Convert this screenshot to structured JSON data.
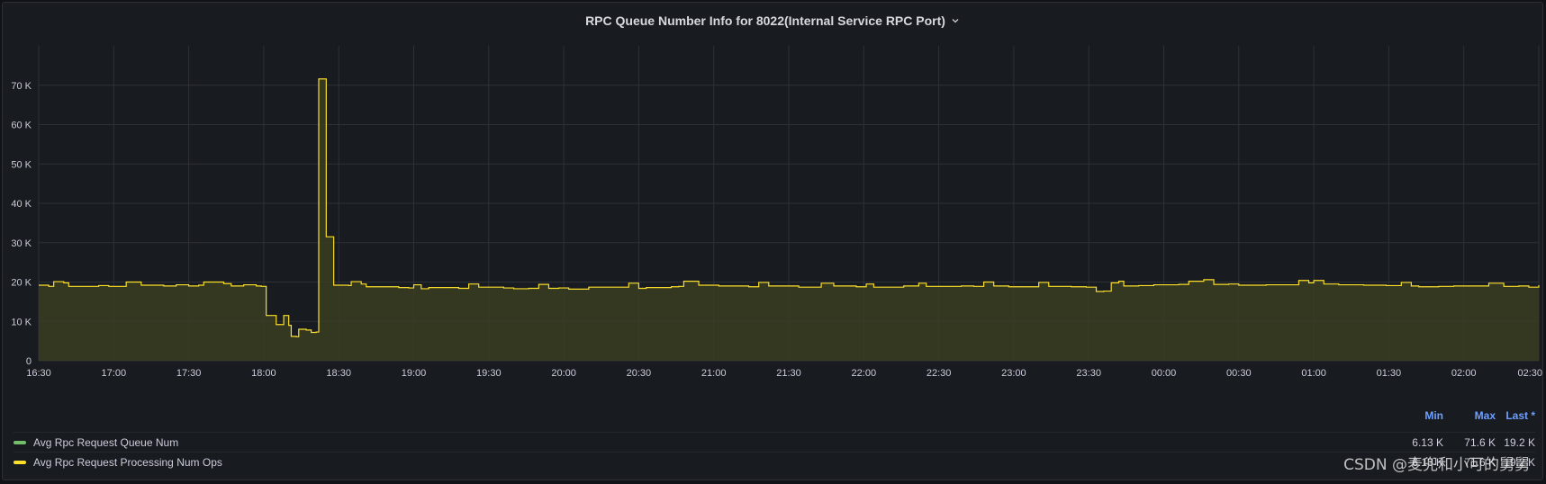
{
  "panel": {
    "title": "RPC Queue Number Info for 8022(Internal Service RPC Port)"
  },
  "colors": {
    "background": "#181b1f",
    "grid": "#2e3138",
    "axis_text": "#ccccdc",
    "series_green": "#73bf69",
    "series_yellow": "#fade2a",
    "area_fill": "#3a3d22"
  },
  "chart_data": {
    "type": "area",
    "x_ticks": [
      "16:30",
      "17:00",
      "17:30",
      "18:00",
      "18:30",
      "19:00",
      "19:30",
      "20:00",
      "20:30",
      "21:00",
      "21:30",
      "22:00",
      "22:30",
      "23:00",
      "23:30",
      "00:00",
      "00:30",
      "01:00",
      "01:30",
      "02:00",
      "02:30"
    ],
    "x_start_minutes": 0,
    "x_end_minutes": 600,
    "ylim": [
      0,
      80000
    ],
    "y_ticks": [
      0,
      10000,
      20000,
      30000,
      40000,
      50000,
      60000,
      70000
    ],
    "y_tick_labels": [
      "0",
      "10 K",
      "20 K",
      "30 K",
      "40 K",
      "50 K",
      "60 K",
      "70 K"
    ],
    "grid": true,
    "legend_position": "bottom",
    "series": [
      {
        "name": "Avg Rpc Request Queue Num",
        "color": "#73bf69",
        "min": "6.13 K",
        "max": "71.6 K",
        "last": "19.2 K"
      },
      {
        "name": "Avg Rpc Request Processing Num Ops",
        "color": "#fade2a",
        "min": "6.13 K",
        "max": "71.6 K",
        "last": "19.2 K",
        "points": [
          [
            0,
            19200
          ],
          [
            4,
            18900
          ],
          [
            6,
            20100
          ],
          [
            10,
            19800
          ],
          [
            12,
            18900
          ],
          [
            20,
            18900
          ],
          [
            24,
            19100
          ],
          [
            28,
            18900
          ],
          [
            35,
            20000
          ],
          [
            41,
            19200
          ],
          [
            50,
            19000
          ],
          [
            55,
            19300
          ],
          [
            60,
            19000
          ],
          [
            64,
            19200
          ],
          [
            66,
            20000
          ],
          [
            74,
            19600
          ],
          [
            77,
            19000
          ],
          [
            82,
            19300
          ],
          [
            87,
            19000
          ],
          [
            89,
            18900
          ],
          [
            91,
            11500
          ],
          [
            93,
            11500
          ],
          [
            95,
            9200
          ],
          [
            98,
            11500
          ],
          [
            100,
            9000
          ],
          [
            101,
            6200
          ],
          [
            103,
            6100
          ],
          [
            104,
            8000
          ],
          [
            107,
            7800
          ],
          [
            109,
            7200
          ],
          [
            111,
            7300
          ],
          [
            112,
            71600
          ],
          [
            114,
            71600
          ],
          [
            115,
            31500
          ],
          [
            117,
            31500
          ],
          [
            118,
            19200
          ],
          [
            121,
            19200
          ],
          [
            124,
            19100
          ],
          [
            125,
            20100
          ],
          [
            129,
            19500
          ],
          [
            131,
            18800
          ],
          [
            140,
            18800
          ],
          [
            144,
            18600
          ],
          [
            148,
            18500
          ],
          [
            150,
            19300
          ],
          [
            153,
            18300
          ],
          [
            156,
            18600
          ],
          [
            163,
            18600
          ],
          [
            168,
            18400
          ],
          [
            172,
            19500
          ],
          [
            176,
            18700
          ],
          [
            180,
            18700
          ],
          [
            186,
            18500
          ],
          [
            190,
            18300
          ],
          [
            196,
            18400
          ],
          [
            200,
            19400
          ],
          [
            204,
            18400
          ],
          [
            208,
            18500
          ],
          [
            212,
            18200
          ],
          [
            217,
            18200
          ],
          [
            220,
            18700
          ],
          [
            232,
            18700
          ],
          [
            236,
            19700
          ],
          [
            240,
            18400
          ],
          [
            243,
            18600
          ],
          [
            248,
            18600
          ],
          [
            253,
            18800
          ],
          [
            256,
            18900
          ],
          [
            258,
            20200
          ],
          [
            264,
            19200
          ],
          [
            272,
            19000
          ],
          [
            284,
            18800
          ],
          [
            288,
            19900
          ],
          [
            292,
            19000
          ],
          [
            299,
            19000
          ],
          [
            304,
            18700
          ],
          [
            309,
            18700
          ],
          [
            313,
            19700
          ],
          [
            318,
            19000
          ],
          [
            327,
            18800
          ],
          [
            331,
            19500
          ],
          [
            334,
            18700
          ],
          [
            340,
            18700
          ],
          [
            346,
            19000
          ],
          [
            352,
            19700
          ],
          [
            355,
            18900
          ],
          [
            361,
            18900
          ],
          [
            369,
            19000
          ],
          [
            374,
            18900
          ],
          [
            378,
            20000
          ],
          [
            382,
            19000
          ],
          [
            388,
            18800
          ],
          [
            396,
            18800
          ],
          [
            400,
            19900
          ],
          [
            404,
            18900
          ],
          [
            413,
            18800
          ],
          [
            419,
            18700
          ],
          [
            423,
            17600
          ],
          [
            426,
            17700
          ],
          [
            429,
            19800
          ],
          [
            432,
            20200
          ],
          [
            434,
            19000
          ],
          [
            440,
            19100
          ],
          [
            446,
            19300
          ],
          [
            456,
            19400
          ],
          [
            460,
            20200
          ],
          [
            466,
            20600
          ],
          [
            470,
            19400
          ],
          [
            476,
            19500
          ],
          [
            480,
            19200
          ],
          [
            491,
            19300
          ],
          [
            500,
            19300
          ],
          [
            504,
            20400
          ],
          [
            508,
            19800
          ],
          [
            510,
            20400
          ],
          [
            514,
            19500
          ],
          [
            520,
            19300
          ],
          [
            530,
            19200
          ],
          [
            539,
            19100
          ],
          [
            545,
            19900
          ],
          [
            549,
            19000
          ],
          [
            552,
            18800
          ],
          [
            560,
            18900
          ],
          [
            566,
            19000
          ],
          [
            574,
            19000
          ],
          [
            580,
            19700
          ],
          [
            586,
            18900
          ],
          [
            592,
            19000
          ],
          [
            596,
            18700
          ],
          [
            600,
            19200
          ]
        ]
      }
    ]
  },
  "legend": {
    "col_min": "Min",
    "col_max": "Max",
    "col_last": "Last *"
  },
  "watermark": "CSDN @麦兜和小可的舅舅"
}
